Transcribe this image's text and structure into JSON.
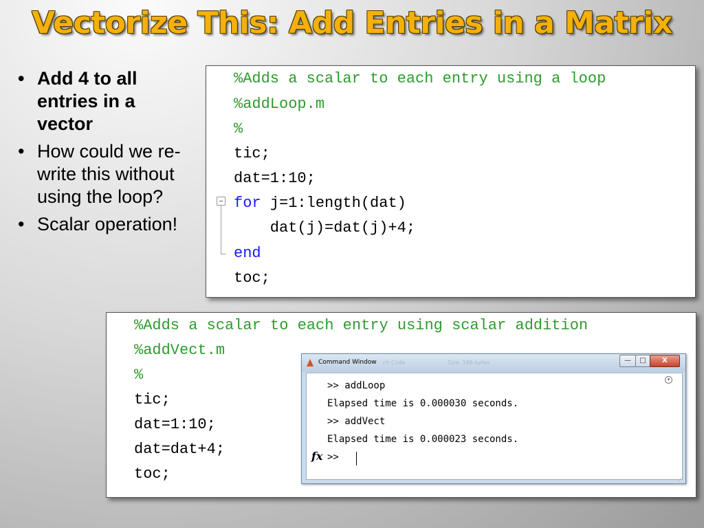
{
  "slide": {
    "title": "Vectorize This: Add Entries in a Matrix",
    "bullets": [
      {
        "text": "Add 4 to all entries in a vector",
        "bold": true
      },
      {
        "text": "How could we re-write this without using the loop?",
        "bold": false
      },
      {
        "text": "Scalar operation!",
        "bold": false
      }
    ],
    "bullet_glyph": "•"
  },
  "code_loop": {
    "lines": [
      "%Adds a scalar to each entry using a loop",
      "%addLoop.m",
      "%",
      "tic;",
      "dat=1:10;",
      "for j=1:length(dat)",
      "    dat(j)=dat(j)+4;",
      "end",
      "toc;"
    ],
    "fold_icon": "minus-box-icon"
  },
  "code_vect": {
    "lines": [
      "%Adds a scalar to each entry using scalar addition",
      "%addVect.m",
      "%",
      "tic;",
      "dat=1:10;",
      "dat=dat+4;",
      "toc;"
    ]
  },
  "command_window": {
    "title": "Command Window",
    "ghost_left": "ch Code",
    "ghost_right": "Size: 186 bytes",
    "minimize": "—",
    "maximize": "□",
    "close": "X",
    "fx_label": "fx",
    "lines": [
      ">> addLoop",
      "Elapsed time is 0.000030 seconds.",
      ">> addVect",
      "Elapsed time is 0.000023 seconds.",
      ">>"
    ]
  },
  "colors": {
    "title": "#f5b00d",
    "comment": "#2e9b2e",
    "keyword": "#1a1aff"
  }
}
